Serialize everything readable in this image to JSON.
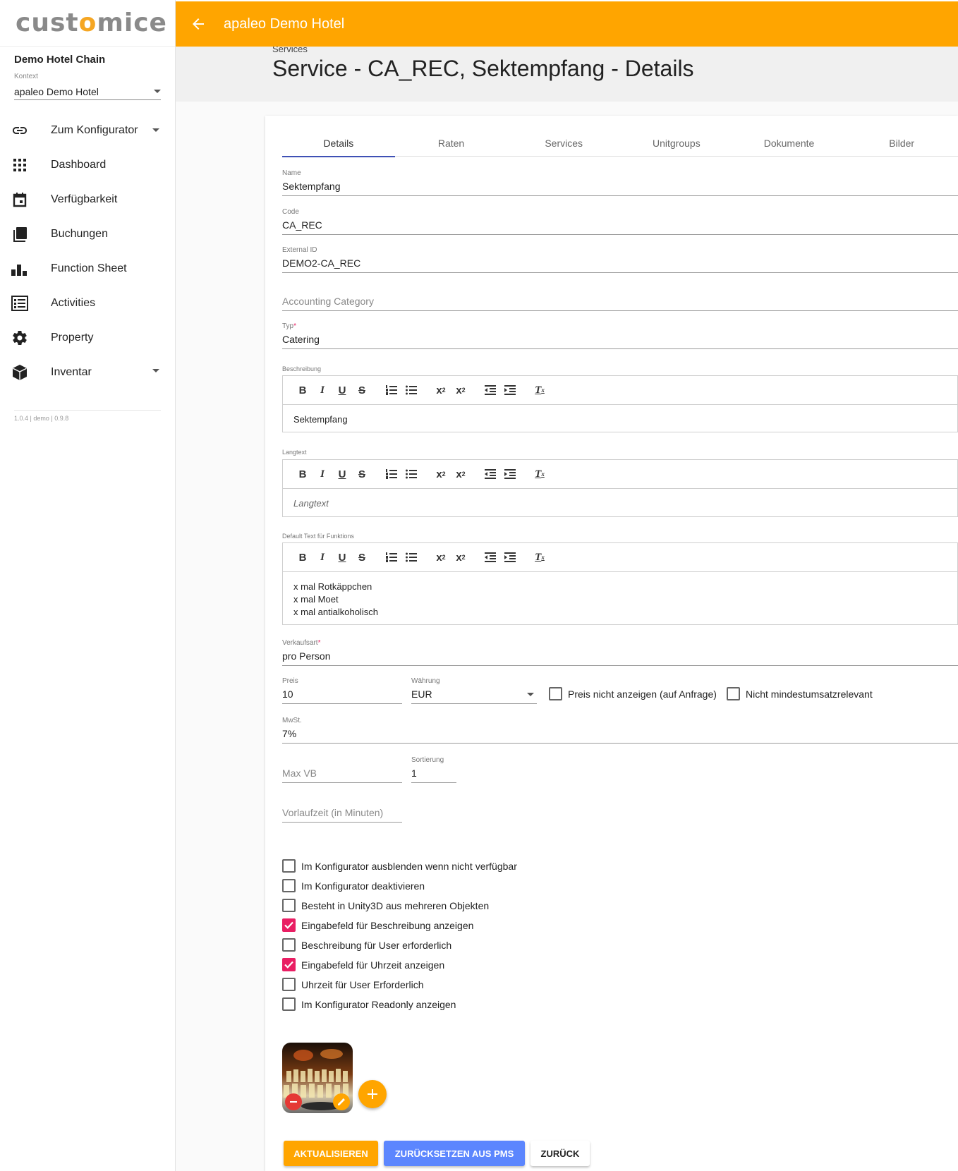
{
  "app": {
    "logo_left": "cust",
    "logo_dot": "o",
    "logo_right": "mice",
    "accent": "#ffa500"
  },
  "sidebar": {
    "chain": "Demo Hotel Chain",
    "context_label": "Kontext",
    "context_value": "apaleo Demo Hotel",
    "items": [
      {
        "label": "Zum Konfigurator",
        "icon": "link-icon",
        "has_caret": true
      },
      {
        "label": "Dashboard",
        "icon": "grid-icon"
      },
      {
        "label": "Verfügbarkeit",
        "icon": "calendar-icon"
      },
      {
        "label": "Buchungen",
        "icon": "stack-icon"
      },
      {
        "label": "Function Sheet",
        "icon": "bar-chart-icon"
      },
      {
        "label": "Activities",
        "icon": "list-icon"
      },
      {
        "label": "Property",
        "icon": "gear-icon"
      },
      {
        "label": "Inventar",
        "icon": "cube-icon",
        "has_caret": true
      }
    ],
    "version": "1.0.4 | demo | 0.9.8"
  },
  "header": {
    "title": "apaleo Demo Hotel"
  },
  "page": {
    "breadcrumb": "Services",
    "title": "Service - CA_REC, Sektempfang - Details"
  },
  "tabs": [
    "Details",
    "Raten",
    "Services",
    "Unitgroups",
    "Dokumente",
    "Bilder"
  ],
  "form": {
    "name_label": "Name",
    "name_value": "Sektempfang",
    "code_label": "Code",
    "code_value": "CA_REC",
    "extid_label": "External ID",
    "extid_value": "DEMO2-CA_REC",
    "acc_placeholder": "Accounting Category",
    "typ_label": "Typ",
    "required_mark": "*",
    "typ_value": "Catering",
    "beschreibung_label": "Beschreibung",
    "beschreibung_body": "Sektempfang",
    "langtext_label": "Langtext",
    "langtext_placeholder": "Langtext",
    "default_label": "Default Text für Funktions",
    "default_lines": [
      "x mal Rotkäppchen",
      "x mal Moet",
      "x mal antialkoholisch"
    ],
    "verkaufsart_label": "Verkaufsart",
    "verkaufsart_value": "pro Person",
    "preis_label": "Preis",
    "preis_value": "10",
    "waehrung_label": "Währung",
    "waehrung_value": "EUR",
    "preis_hidden_label": "Preis nicht anzeigen (auf Anfrage)",
    "mindest_label": "Nicht mindestumsatzrelevant",
    "mwst_label": "MwSt.",
    "mwst_value": "7%",
    "maxvb_placeholder": "Max VB",
    "sort_label": "Sortierung",
    "sort_value": "1",
    "vorlauf_placeholder": "Vorlaufzeit (in Minuten)"
  },
  "toolbar_glyphs": [
    "B",
    "I",
    "U",
    "S",
    "ol",
    "ul",
    "sub",
    "sup",
    "outdent",
    "indent",
    "clear"
  ],
  "checkboxes": [
    {
      "label": "Im Konfigurator ausblenden wenn nicht verfügbar",
      "checked": false
    },
    {
      "label": "Im Konfigurator deaktivieren",
      "checked": false
    },
    {
      "label": "Besteht in Unity3D aus mehreren Objekten",
      "checked": false
    },
    {
      "label": "Eingabefeld für Beschreibung anzeigen",
      "checked": true
    },
    {
      "label": "Beschreibung für User erforderlich",
      "checked": false
    },
    {
      "label": "Eingabefeld für Uhrzeit anzeigen",
      "checked": true
    },
    {
      "label": "Uhrzeit für User Erforderlich",
      "checked": false
    },
    {
      "label": "Im Konfigurator Readonly anzeigen",
      "checked": false
    }
  ],
  "buttons": {
    "update": "AKTUALISIEREN",
    "reset": "ZURÜCKSETZEN AUS PMS",
    "back": "ZURÜCK"
  },
  "colors": {
    "checkbox_on": "#e91e63",
    "tab_indicator": "#3f51b5",
    "btn_blue": "#5c86fe"
  }
}
